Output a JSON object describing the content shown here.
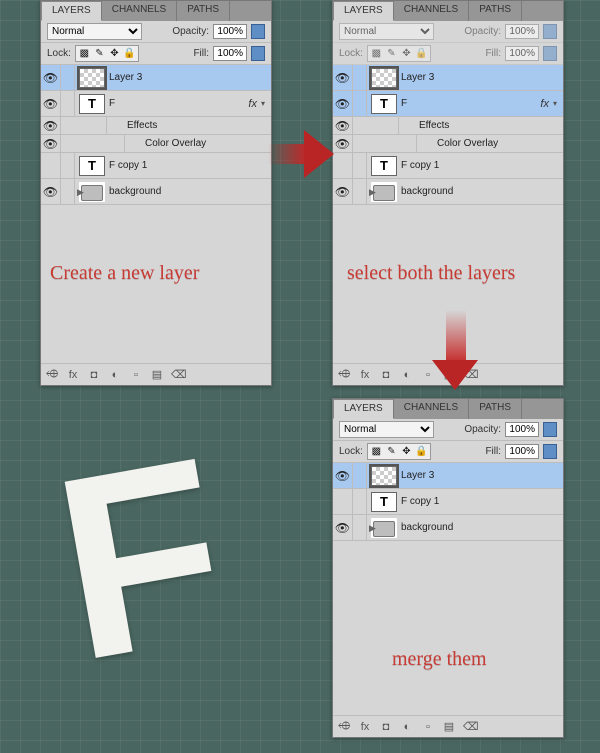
{
  "letter": "F",
  "captions": {
    "create": "Create a new layer",
    "select": "select both the layers",
    "merge": "merge them"
  },
  "common": {
    "tab_layers": "LAYERS",
    "tab_channels": "CHANNELS",
    "tab_paths": "PATHS",
    "blend_mode": "Normal",
    "opacity_label": "Opacity:",
    "opacity_value": "100%",
    "lock_label": "Lock:",
    "fill_label": "Fill:",
    "fill_value": "100%",
    "fx_label": "fx",
    "effects_label": "Effects",
    "coloroverlay_label": "Color Overlay"
  },
  "panel1": {
    "layers": [
      {
        "name": "Layer 3",
        "type": "pixel",
        "selected": true,
        "visible": true
      },
      {
        "name": "F",
        "type": "type",
        "visible": true,
        "fx": true
      },
      {
        "name": "F copy 1",
        "type": "type",
        "visible": false
      },
      {
        "name": "background",
        "type": "folder",
        "visible": true
      }
    ]
  },
  "panel2": {
    "layers": [
      {
        "name": "Layer 3",
        "type": "pixel",
        "selected": true,
        "visible": true
      },
      {
        "name": "F",
        "type": "type",
        "visible": true,
        "fx": true,
        "selected": true
      },
      {
        "name": "F copy 1",
        "type": "type",
        "visible": false
      },
      {
        "name": "background",
        "type": "folder",
        "visible": true
      }
    ]
  },
  "panel3": {
    "layers": [
      {
        "name": "Layer 3",
        "type": "pixel",
        "selected": true,
        "visible": true
      },
      {
        "name": "F copy 1",
        "type": "type",
        "visible": false
      },
      {
        "name": "background",
        "type": "folder",
        "visible": true
      }
    ]
  },
  "footer_icons": [
    "⬲",
    "fx",
    "◘",
    "◐",
    "▫",
    "▤",
    "⌫"
  ]
}
